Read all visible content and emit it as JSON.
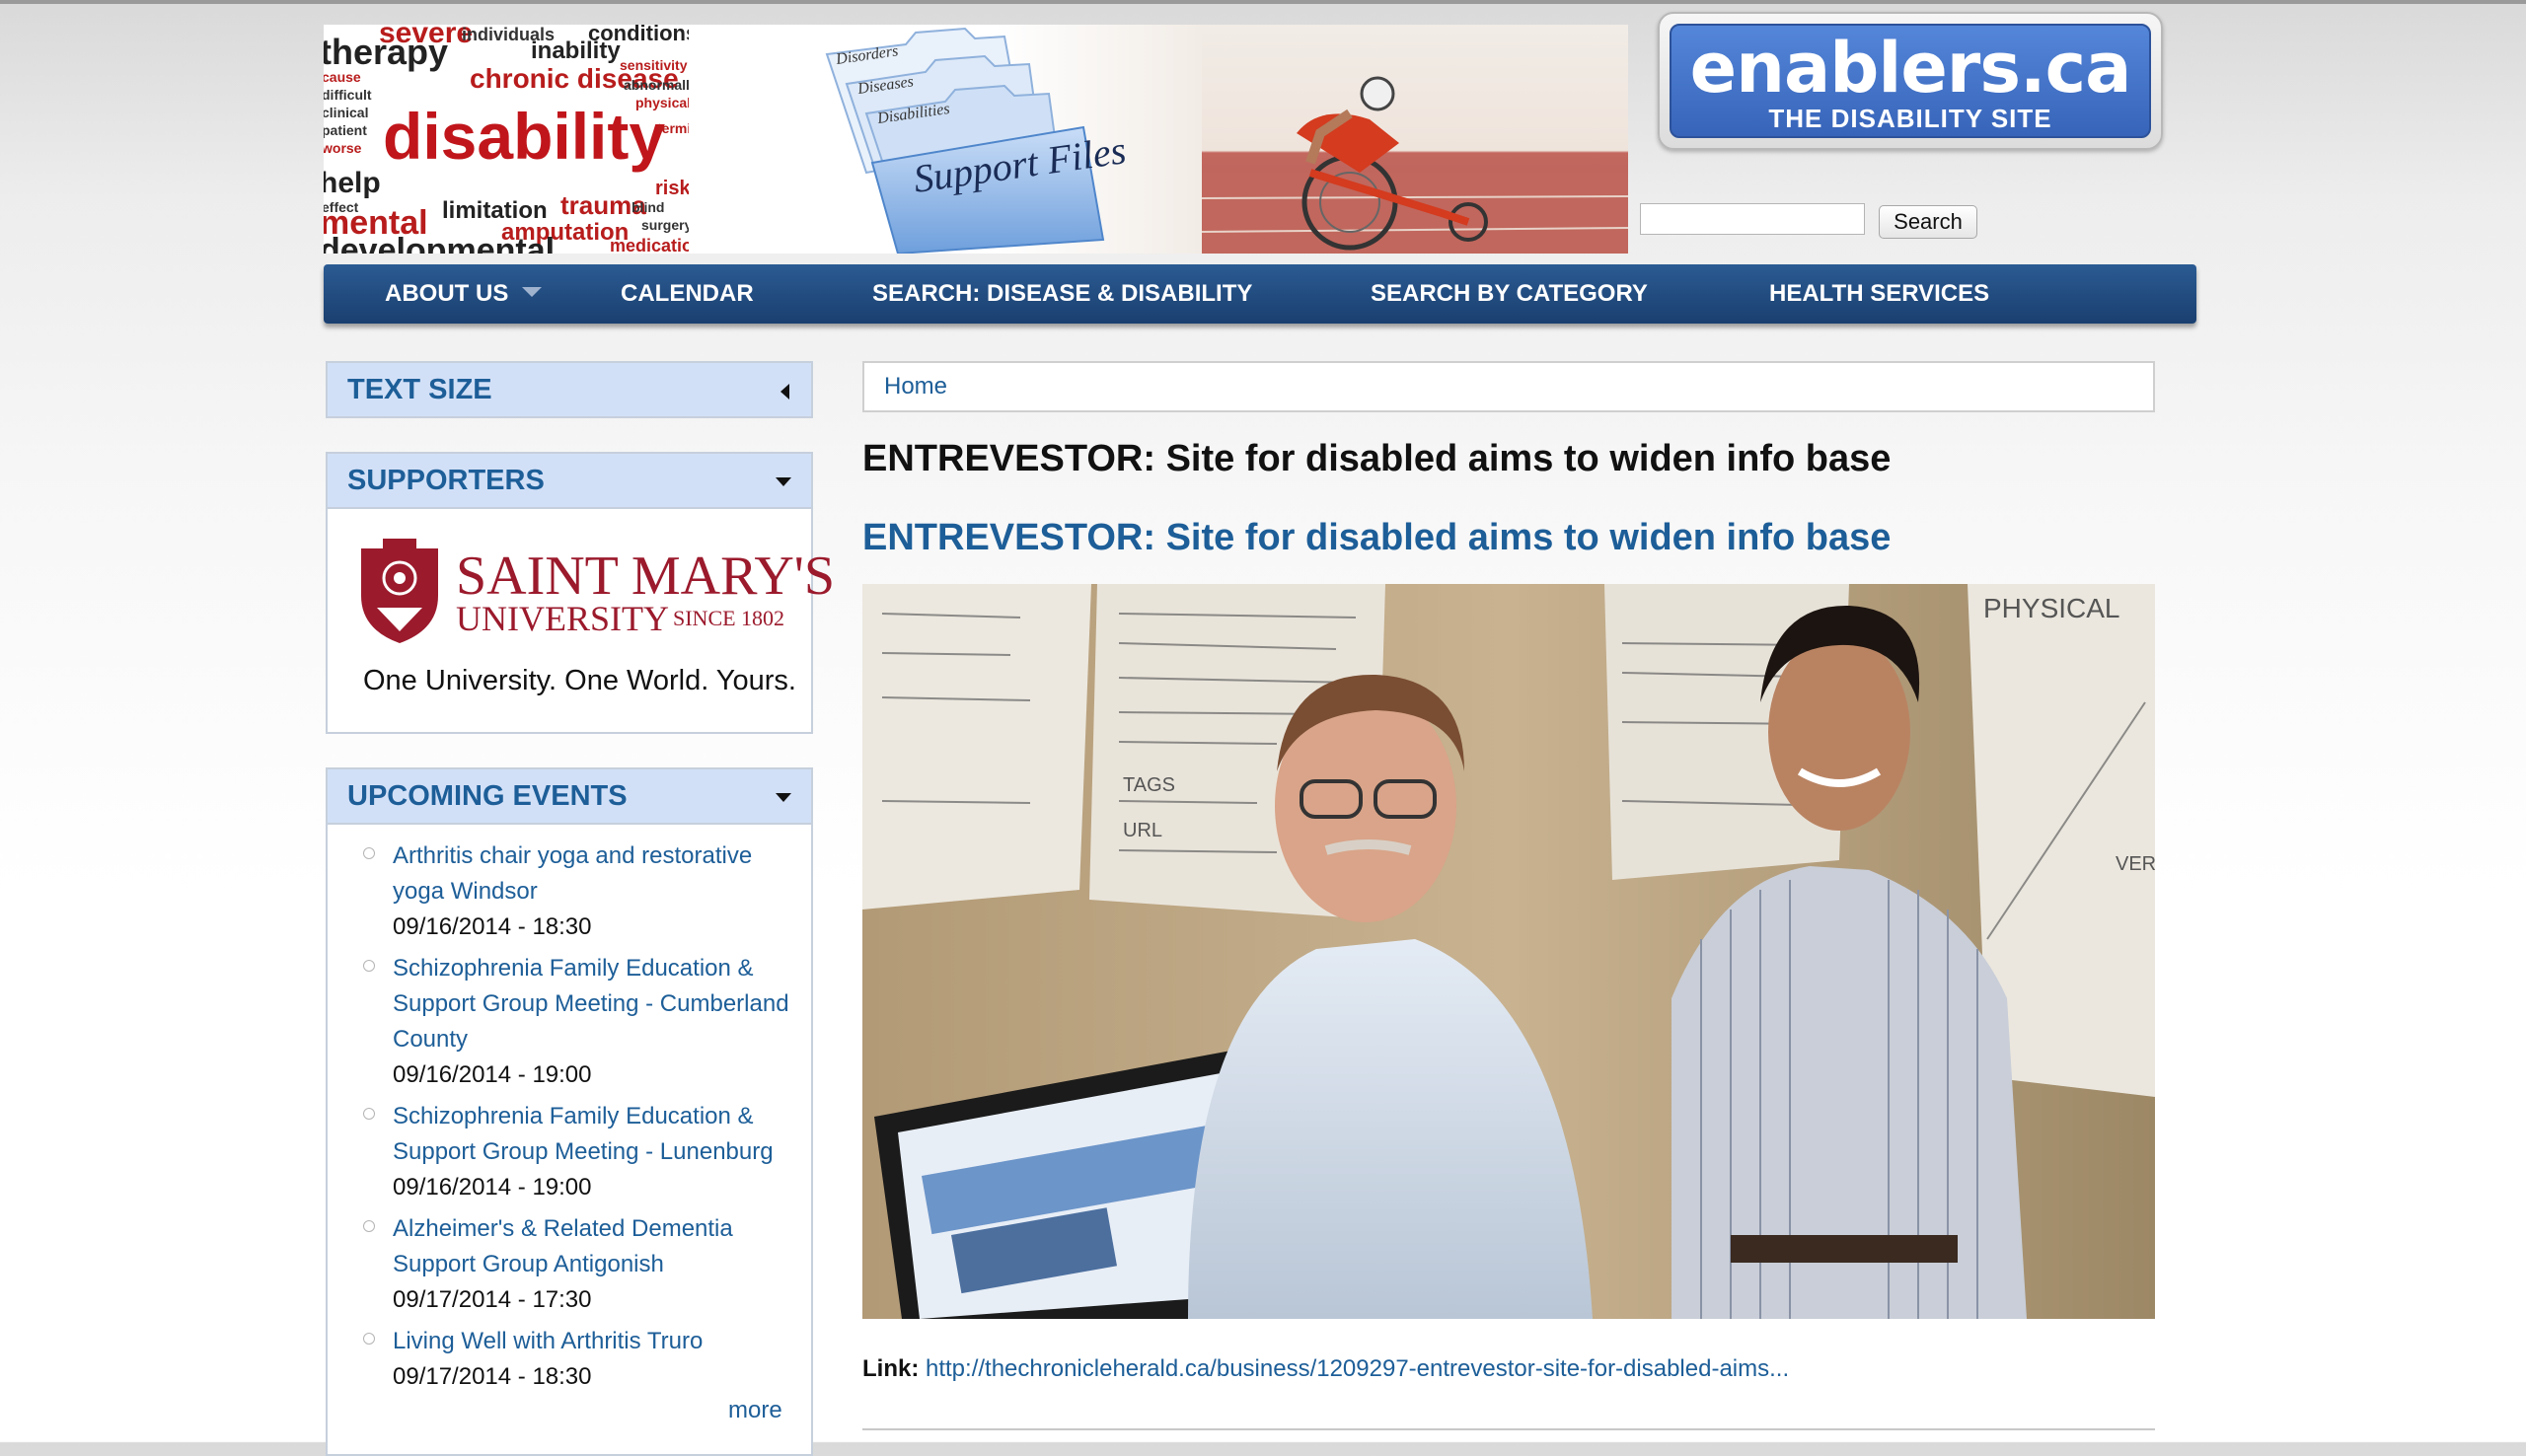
{
  "banner": {
    "words": [
      "therapy",
      "severe",
      "inability",
      "chronic disease",
      "disability",
      "limitation",
      "trauma",
      "mental",
      "amputation",
      "developmental",
      "risk",
      "medication",
      "individuals",
      "conditions",
      "sensitivity",
      "abnormally",
      "physical",
      "terminology",
      "surgery",
      "blind",
      "help",
      "effect",
      "worse",
      "patient",
      "clinical",
      "difficult",
      "cause"
    ],
    "files_tab_labels": [
      "Disorders",
      "Diseases",
      "Disabilities"
    ],
    "files_label": "Support Files"
  },
  "logo": {
    "name": "enablers.ca",
    "tagline": "THE DISABILITY SITE"
  },
  "search": {
    "button_label": "Search",
    "value": ""
  },
  "nav": {
    "items": [
      {
        "label": "ABOUT US",
        "has_dropdown": true
      },
      {
        "label": "CALENDAR"
      },
      {
        "label": "SEARCH: DISEASE & DISABILITY"
      },
      {
        "label": "SEARCH BY CATEGORY"
      },
      {
        "label": "HEALTH SERVICES"
      }
    ]
  },
  "sidebar": {
    "text_size": {
      "title": "TEXT SIZE"
    },
    "supporters": {
      "title": "SUPPORTERS",
      "logo_name_1": "SAINT MARY'S",
      "logo_name_2": "UNIVERSITY",
      "logo_since": "SINCE 1802",
      "slogan": "One University. One World. Yours."
    },
    "events": {
      "title": "UPCOMING EVENTS",
      "items": [
        {
          "title": "Arthritis chair yoga and restorative yoga Windsor",
          "date": "09/16/2014 - 18:30"
        },
        {
          "title": "Schizophrenia Family Education & Support Group Meeting - Cumberland County",
          "date": "09/16/2014 - 19:00"
        },
        {
          "title": "Schizophrenia Family Education & Support Group Meeting - Lunenburg",
          "date": "09/16/2014 - 19:00"
        },
        {
          "title": "Alzheimer's & Related Dementia Support Group Antigonish",
          "date": "09/17/2014 - 17:30"
        },
        {
          "title": "Living Well with Arthritis Truro",
          "date": "09/17/2014 - 18:30"
        }
      ],
      "more_label": "more"
    }
  },
  "main": {
    "breadcrumb": "Home",
    "page_title": "ENTREVESTOR: Site for disabled aims to widen info base",
    "article_title": "ENTREVESTOR: Site for disabled aims to widen info base",
    "photo_whiteboard_text": [
      "PHYSICAL",
      "TAGS",
      "URL",
      "VER"
    ],
    "link_label": "Link:",
    "link_url": "http://thechronicleherald.ca/business/1209297-entrevestor-site-for-disabled-aims..."
  },
  "colors": {
    "link": "#1d5e98",
    "nav_bg": "#1f4a7e",
    "block_header_bg": "#d2e0f7",
    "logo_blue": "#3d6cc1",
    "smu_red": "#9b1a2c"
  }
}
